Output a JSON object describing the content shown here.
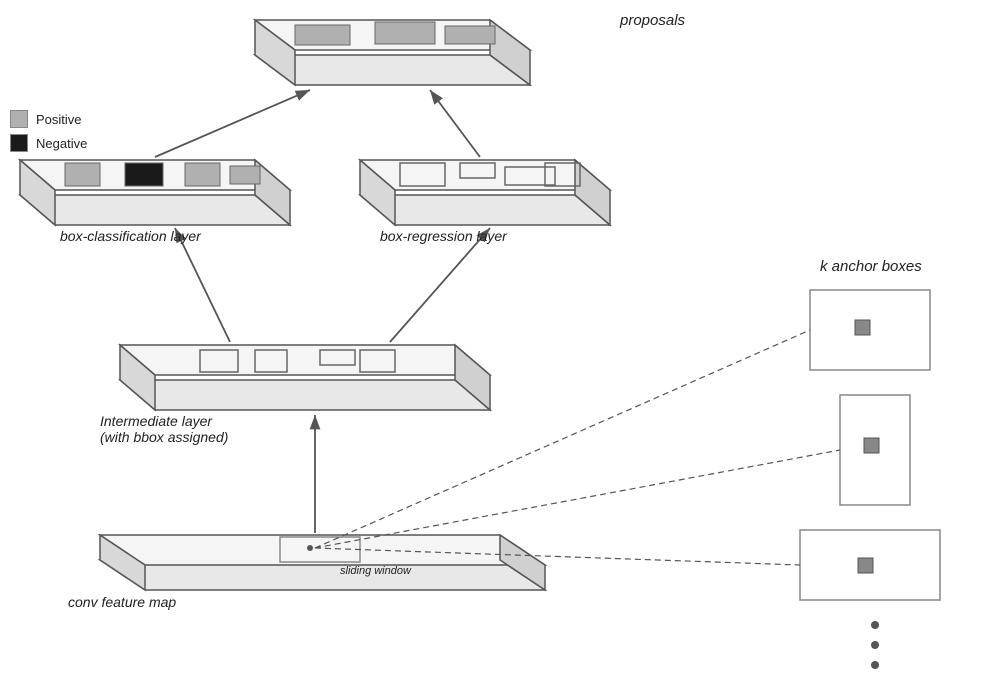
{
  "legend": {
    "positive_label": "Positive",
    "negative_label": "Negative",
    "positive_color": "#b0b0b0",
    "negative_color": "#1a1a1a"
  },
  "labels": {
    "proposals": "proposals",
    "box_classification": "box-classification layer",
    "box_regression": "box-regression layer",
    "intermediate": "Intermediate layer",
    "intermediate_sub": "(with bbox assigned)",
    "conv_feature": "conv feature map",
    "sliding_window": "sliding window",
    "k_anchor": "k anchor boxes"
  }
}
